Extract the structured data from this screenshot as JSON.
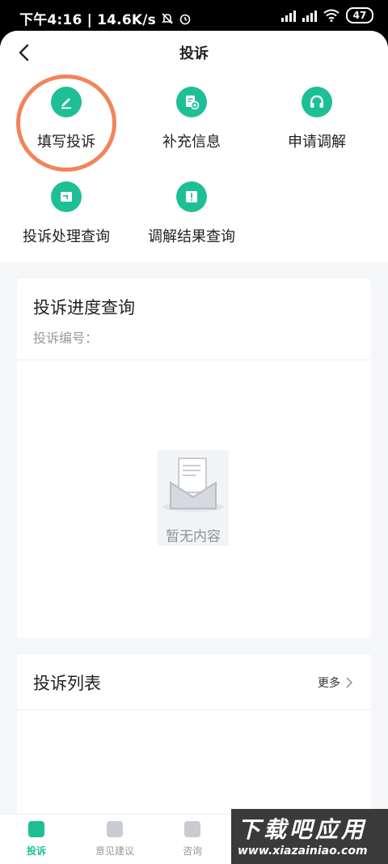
{
  "status_bar": {
    "time_speed": "下午4:16 | 14.6K/s",
    "battery": "47"
  },
  "header": {
    "title": "投诉"
  },
  "actions": [
    {
      "label": "填写投诉",
      "icon": "edit-icon"
    },
    {
      "label": "补充信息",
      "icon": "add-document-icon"
    },
    {
      "label": "申请调解",
      "icon": "headset-icon"
    },
    {
      "label": "投诉处理查询",
      "icon": "process-query-icon"
    },
    {
      "label": "调解结果查询",
      "icon": "result-query-icon"
    }
  ],
  "progress_card": {
    "title": "投诉进度查询",
    "complaint_no_label": "投诉编号：",
    "empty_text": "暂无内容"
  },
  "list_card": {
    "title": "投诉列表",
    "more": "更多"
  },
  "tabbar": {
    "items": [
      {
        "label": "投诉",
        "active": true
      },
      {
        "label": "意见建议",
        "active": false
      },
      {
        "label": "咨询",
        "active": false
      }
    ]
  },
  "watermark": {
    "title": "下载吧应用",
    "url": "www.xiazainiao.com"
  },
  "colors": {
    "accent": "#1fbf96",
    "highlight": "#f2845a",
    "background": "#f5f6f8"
  }
}
